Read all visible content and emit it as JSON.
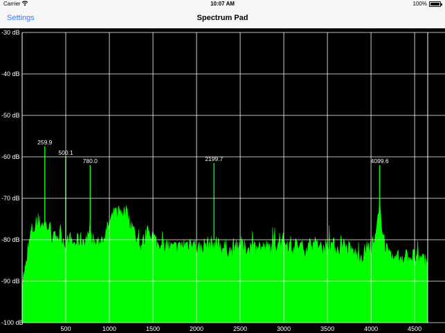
{
  "status_bar": {
    "carrier": "Carrier",
    "time": "10:07 AM",
    "battery": "100%",
    "wifi_icon": "wifi-icon",
    "battery_icon": "battery-icon"
  },
  "nav": {
    "back_label": "Settings",
    "title": "Spectrum Pad"
  },
  "chart_data": {
    "type": "area",
    "xlabel": "",
    "ylabel": "",
    "xlim": [
      0,
      4650
    ],
    "ylim": [
      -100,
      -30
    ],
    "x_ticks": [
      500,
      1000,
      1500,
      2000,
      2500,
      3000,
      3500,
      4000,
      4500
    ],
    "y_ticks": [
      -30,
      -40,
      -50,
      -60,
      -70,
      -80,
      -90,
      -100
    ],
    "y_tick_labels": [
      "-30 dB",
      "-40 dB",
      "-50 dB",
      "-60 dB",
      "-70 dB",
      "-80 dB",
      "-90 dB",
      "-100 dB"
    ],
    "grid": true,
    "fill_color": "#00ff00",
    "background": "#000000",
    "grid_color": "#ffffff",
    "spectrum": {
      "x": [
        0,
        50,
        100,
        150,
        200,
        250,
        300,
        350,
        400,
        450,
        500,
        550,
        600,
        650,
        700,
        750,
        800,
        850,
        900,
        950,
        1000,
        1050,
        1100,
        1150,
        1200,
        1250,
        1300,
        1350,
        1400,
        1450,
        1500,
        1550,
        1600,
        1650,
        1700,
        1750,
        1800,
        1850,
        1900,
        1950,
        2000,
        2050,
        2100,
        2150,
        2200,
        2250,
        2300,
        2350,
        2400,
        2450,
        2500,
        2550,
        2600,
        2650,
        2700,
        2750,
        2800,
        2850,
        2900,
        2950,
        3000,
        3050,
        3100,
        3150,
        3200,
        3250,
        3300,
        3350,
        3400,
        3450,
        3500,
        3550,
        3600,
        3650,
        3700,
        3750,
        3800,
        3850,
        3900,
        3950,
        4000,
        4050,
        4100,
        4150,
        4200,
        4250,
        4300,
        4350,
        4400,
        4450,
        4500,
        4550,
        4600,
        4650
      ],
      "y": [
        -90,
        -86,
        -78,
        -77,
        -76,
        -76,
        -77,
        -80,
        -79,
        -79,
        -81,
        -80,
        -81,
        -80,
        -80,
        -80,
        -80,
        -81,
        -80,
        -79,
        -76,
        -74,
        -73,
        -73,
        -74,
        -76,
        -79,
        -82,
        -80,
        -78,
        -79,
        -81,
        -82,
        -81,
        -82,
        -82,
        -82,
        -81,
        -81,
        -80,
        -82,
        -82,
        -81,
        -81,
        -81,
        -81,
        -82,
        -82,
        -83,
        -81,
        -81,
        -82,
        -82,
        -82,
        -81,
        -82,
        -82,
        -82,
        -81,
        -81,
        -80,
        -81,
        -82,
        -81,
        -82,
        -82,
        -81,
        -81,
        -82,
        -82,
        -81,
        -81,
        -82,
        -82,
        -82,
        -82,
        -83,
        -84,
        -84,
        -82,
        -83,
        -80,
        -72,
        -80,
        -84,
        -85,
        -84,
        -84,
        -84,
        -84,
        -84,
        -85,
        -85,
        -85
      ]
    },
    "peaks": [
      {
        "x": 259.9,
        "y": -57.5,
        "label": "259.9"
      },
      {
        "x": 500.1,
        "y": -60,
        "label": "500.1"
      },
      {
        "x": 780.0,
        "y": -62,
        "label": "780.0"
      },
      {
        "x": 2199.7,
        "y": -61.5,
        "label": "2199.7"
      },
      {
        "x": 4099.6,
        "y": -62,
        "label": "4099.6"
      }
    ]
  }
}
